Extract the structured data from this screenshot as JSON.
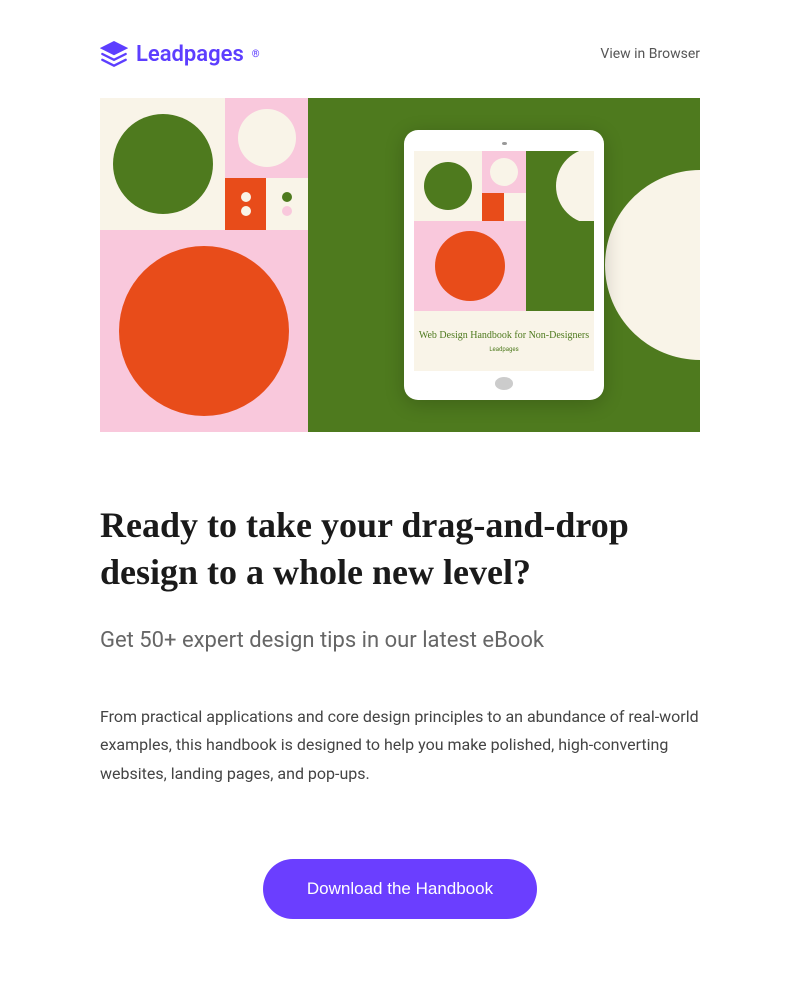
{
  "header": {
    "logo_text": "Leadpages",
    "view_browser": "View in Browser"
  },
  "hero": {
    "tablet_title": "Web Design Handbook for Non-Designers",
    "tablet_brand": "Leadpages"
  },
  "content": {
    "headline": "Ready to take your drag-and-drop design to a whole new level?",
    "subheadline": "Get 50+ expert design tips in our latest eBook",
    "body": "From practical applications and core design principles to an abundance of real-world examples, this handbook is designed to help you make polished, high-converting websites, landing pages, and pop-ups.",
    "cta_label": "Download the Handbook"
  },
  "colors": {
    "brand": "#5d3eff",
    "cta": "#6b3eff",
    "green": "#4e7a1e",
    "orange": "#e84c1a",
    "pink": "#f9c8dc",
    "cream": "#f9f4e8"
  }
}
